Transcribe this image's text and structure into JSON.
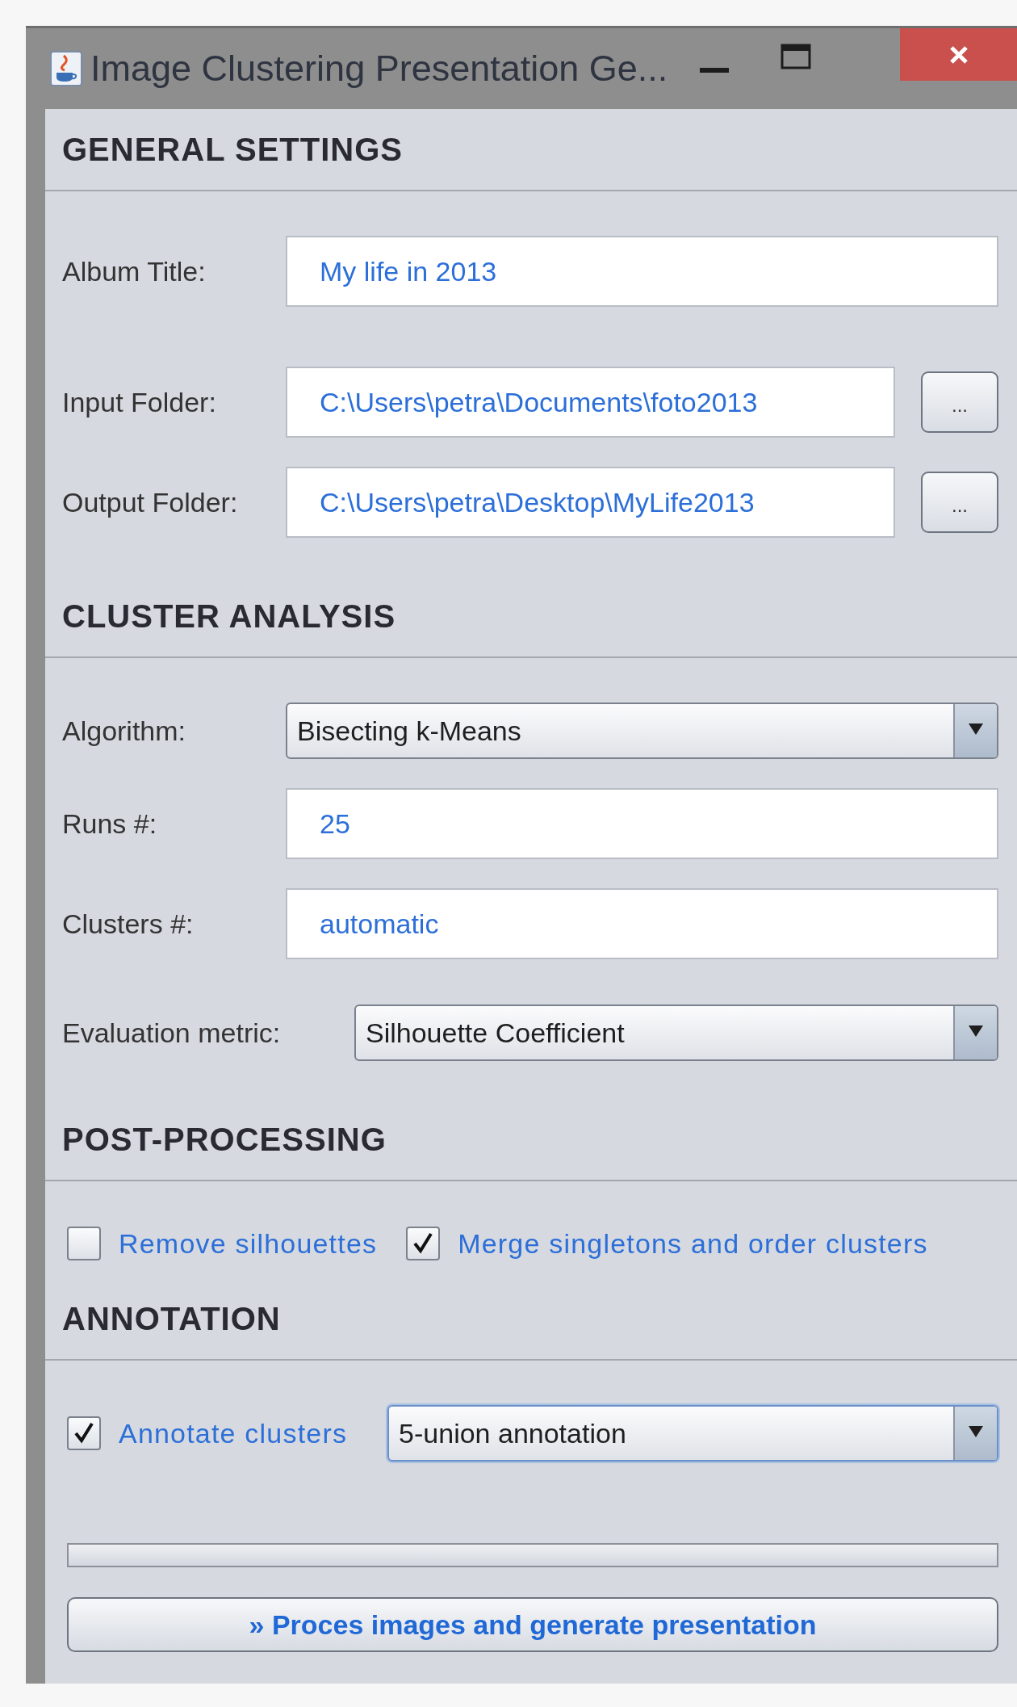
{
  "window": {
    "title": "Image Clustering Presentation Ge..."
  },
  "sections": [
    {
      "title": "GENERAL SETTINGS",
      "rows": [
        {
          "kind": "text",
          "label": "Album Title:",
          "value": "My life in 2013"
        },
        {
          "kind": "folder",
          "label": "Input Folder:",
          "value": "C:\\Users\\petra\\Documents\\foto2013",
          "button": "..."
        },
        {
          "kind": "folder",
          "label": "Output Folder:",
          "value": "C:\\Users\\petra\\Desktop\\MyLife2013",
          "button": "..."
        }
      ]
    },
    {
      "title": "CLUSTER ANALYSIS",
      "rows": [
        {
          "kind": "combo",
          "label": "Algorithm:",
          "value": "Bisecting k-Means"
        },
        {
          "kind": "text",
          "label": "Runs #:",
          "value": "25"
        },
        {
          "kind": "text",
          "label": "Clusters #:",
          "value": "automatic"
        },
        {
          "kind": "combo",
          "label": "Evaluation metric:",
          "value": "Silhouette Coefficient"
        }
      ]
    },
    {
      "title": "POST-PROCESSING",
      "rows": [
        {
          "kind": "checks",
          "items": [
            {
              "label": "Remove silhouettes",
              "checked": false
            },
            {
              "label": "Merge singletons and order clusters",
              "checked": true
            }
          ]
        }
      ]
    },
    {
      "title": "ANNOTATION",
      "rows": [
        {
          "kind": "check_combo",
          "label": "Annotate clusters",
          "checked": true,
          "value": "5-union annotation"
        }
      ]
    }
  ],
  "progress": {
    "level": 0
  },
  "action_button": {
    "label": "» Proces images and generate presentation"
  }
}
